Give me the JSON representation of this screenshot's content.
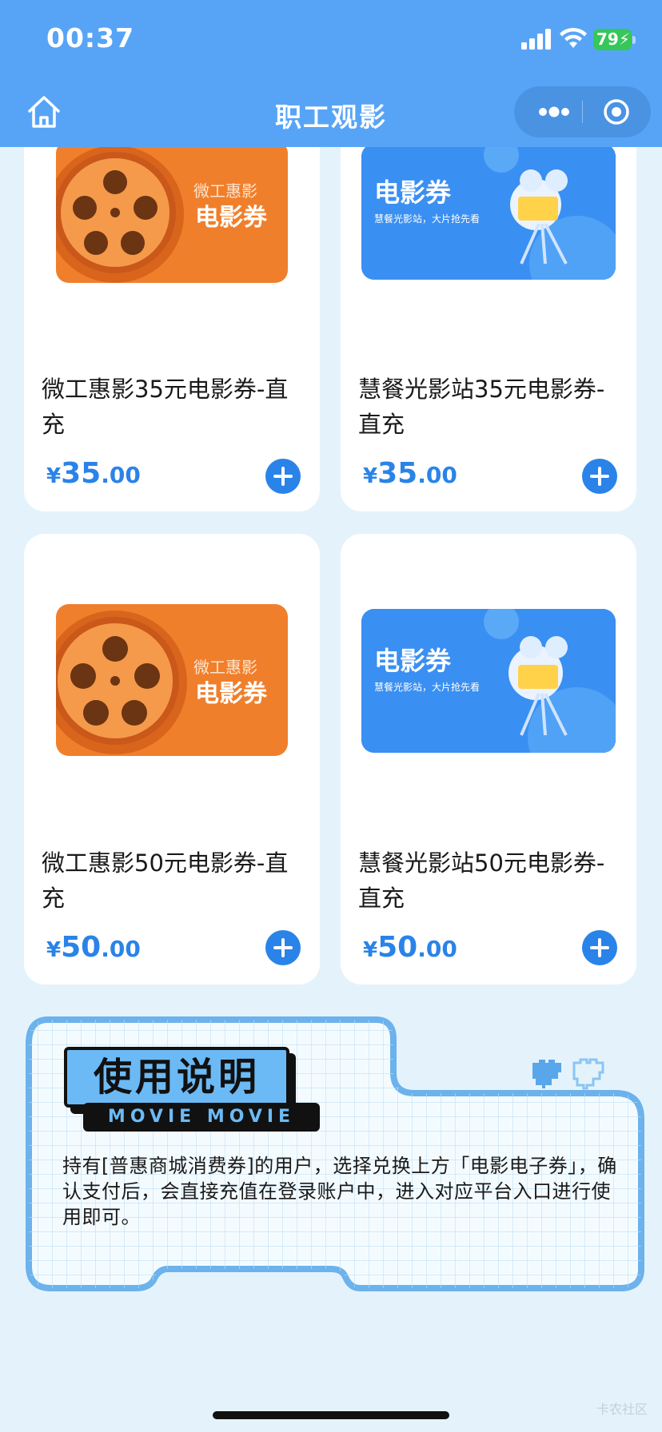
{
  "status_bar": {
    "time": "00:37",
    "battery": "79"
  },
  "nav": {
    "title": "职工观影"
  },
  "products": [
    {
      "title": "微工惠影35元电影券-直充",
      "price_int": "35",
      "price_dec": ".00",
      "currency": "¥",
      "thumb": {
        "style": "orange",
        "line1": "微工惠影",
        "line2": "电影券"
      }
    },
    {
      "title": "慧餐光影站35元电影券-直充",
      "price_int": "35",
      "price_dec": ".00",
      "currency": "¥",
      "thumb": {
        "style": "blue",
        "line1": "电影券",
        "line2": "慧餐光影站，大片抢先看"
      }
    },
    {
      "title": "微工惠影50元电影券-直充",
      "price_int": "50",
      "price_dec": ".00",
      "currency": "¥",
      "thumb": {
        "style": "orange",
        "line1": "微工惠影",
        "line2": "电影券"
      }
    },
    {
      "title": "慧餐光影站50元电影券-直充",
      "price_int": "50",
      "price_dec": ".00",
      "currency": "¥",
      "thumb": {
        "style": "blue",
        "line1": "电影券",
        "line2": "慧餐光影站，大片抢先看"
      }
    }
  ],
  "notice": {
    "heading": "使用说明",
    "subheading": "MOVIE MOVIE",
    "text": "持有[普惠商城消费券]的用户，选择兑换上方「电影电子券」，确认支付后，会直接充值在登录账户中，进入对应平台入口进行使用即可。"
  },
  "watermark": "卡农社区",
  "colors": {
    "header": "#57a4f7",
    "accent": "#2a83e8",
    "background": "#e4f3fb",
    "orange": "#f07f2c"
  },
  "icons": {
    "home": "home-icon",
    "more": "more-dots-icon",
    "close": "target-close-icon",
    "add": "plus-circle-icon"
  }
}
